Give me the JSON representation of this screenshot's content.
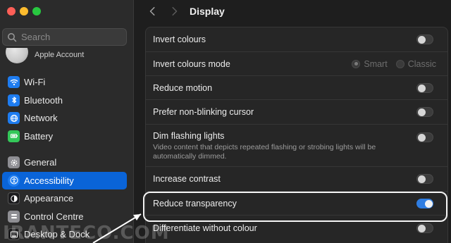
{
  "window": {
    "traffic_lights": [
      "#ff5f57",
      "#febc2e",
      "#28c840"
    ]
  },
  "sidebar": {
    "search_placeholder": "Search",
    "account_label": "Apple Account",
    "items": [
      {
        "label": "Wi-Fi",
        "icon": "wifi-icon",
        "color": "#1e7cf0",
        "active": false
      },
      {
        "label": "Bluetooth",
        "icon": "bluetooth-icon",
        "color": "#1e7cf0",
        "active": false
      },
      {
        "label": "Network",
        "icon": "globe-icon",
        "color": "#1e7cf0",
        "active": false
      },
      {
        "label": "Battery",
        "icon": "battery-icon",
        "color": "#34c759",
        "active": false
      },
      {
        "label": "General",
        "icon": "gear-icon",
        "color": "#8e8e93",
        "active": false
      },
      {
        "label": "Accessibility",
        "icon": "accessibility-icon",
        "color": "#1e7cf0",
        "active": true
      },
      {
        "label": "Appearance",
        "icon": "appearance-icon",
        "color": "#1c1c1e",
        "active": false
      },
      {
        "label": "Control Centre",
        "icon": "control-centre-icon",
        "color": "#8e8e93",
        "active": false
      },
      {
        "label": "Desktop & Dock",
        "icon": "dock-icon",
        "color": "#1c1c1e",
        "active": false
      }
    ]
  },
  "header": {
    "title": "Display"
  },
  "settings": {
    "invert_colours": {
      "label": "Invert colours",
      "on": false
    },
    "invert_mode": {
      "label": "Invert colours mode",
      "options": [
        "Smart",
        "Classic"
      ],
      "selected": "Smart"
    },
    "reduce_motion": {
      "label": "Reduce motion",
      "on": false
    },
    "non_blinking": {
      "label": "Prefer non-blinking cursor",
      "on": false
    },
    "dim_flashing": {
      "label": "Dim flashing lights",
      "desc": "Video content that depicts repeated flashing or strobing lights will be automatically dimmed.",
      "on": false
    },
    "increase_contrast": {
      "label": "Increase contrast",
      "on": false
    },
    "reduce_transparency": {
      "label": "Reduce transparency",
      "on": true
    },
    "differentiate": {
      "label": "Differentiate without colour",
      "on": false
    }
  },
  "watermark": "IRANTECO.COM",
  "accent": "#0a64d8"
}
